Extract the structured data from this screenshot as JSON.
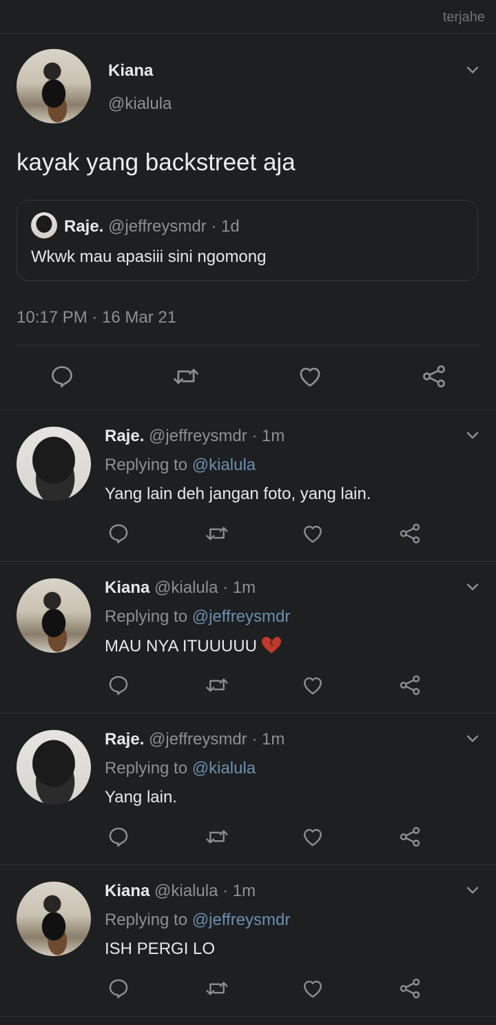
{
  "watermark": "terjahe",
  "main_tweet": {
    "name": "Kiana",
    "handle": "@kialula",
    "text": "kayak yang backstreet aja",
    "quote": {
      "name": "Raje.",
      "meta": "@jeffreysmdr · 1d",
      "text": "Wkwk mau apasiii sini ngomong"
    },
    "timestamp": "10:17 PM · 16 Mar 21"
  },
  "replies": [
    {
      "name": "Raje.",
      "meta": "@jeffreysmdr · 1m",
      "replying_label": "Replying to",
      "replying_to": "@kialula",
      "text": "Yang lain deh jangan foto, yang lain.",
      "avatar": "raje"
    },
    {
      "name": "Kiana",
      "meta": "@kialula · 1m",
      "replying_label": "Replying to",
      "replying_to": "@jeffreysmdr",
      "text": "MAU NYA ITUUUUU",
      "avatar": "kiana",
      "emoji": "broken-heart-icon"
    },
    {
      "name": "Raje.",
      "meta": "@jeffreysmdr · 1m",
      "replying_label": "Replying to",
      "replying_to": "@kialula",
      "text": "Yang lain.",
      "avatar": "raje"
    },
    {
      "name": "Kiana",
      "meta": "@kialula · 1m",
      "replying_label": "Replying to",
      "replying_to": "@jeffreysmdr",
      "text": "ISH PERGI LO",
      "avatar": "kiana"
    }
  ],
  "icons": [
    "reply-icon",
    "retweet-icon",
    "like-icon",
    "share-icon",
    "chevron-down-icon"
  ],
  "colors": {
    "background": "#1e1f21",
    "text": "#e7e9ea",
    "muted": "#8b9196",
    "mention": "#6a8fb0",
    "broken_heart": "#c0392b"
  }
}
